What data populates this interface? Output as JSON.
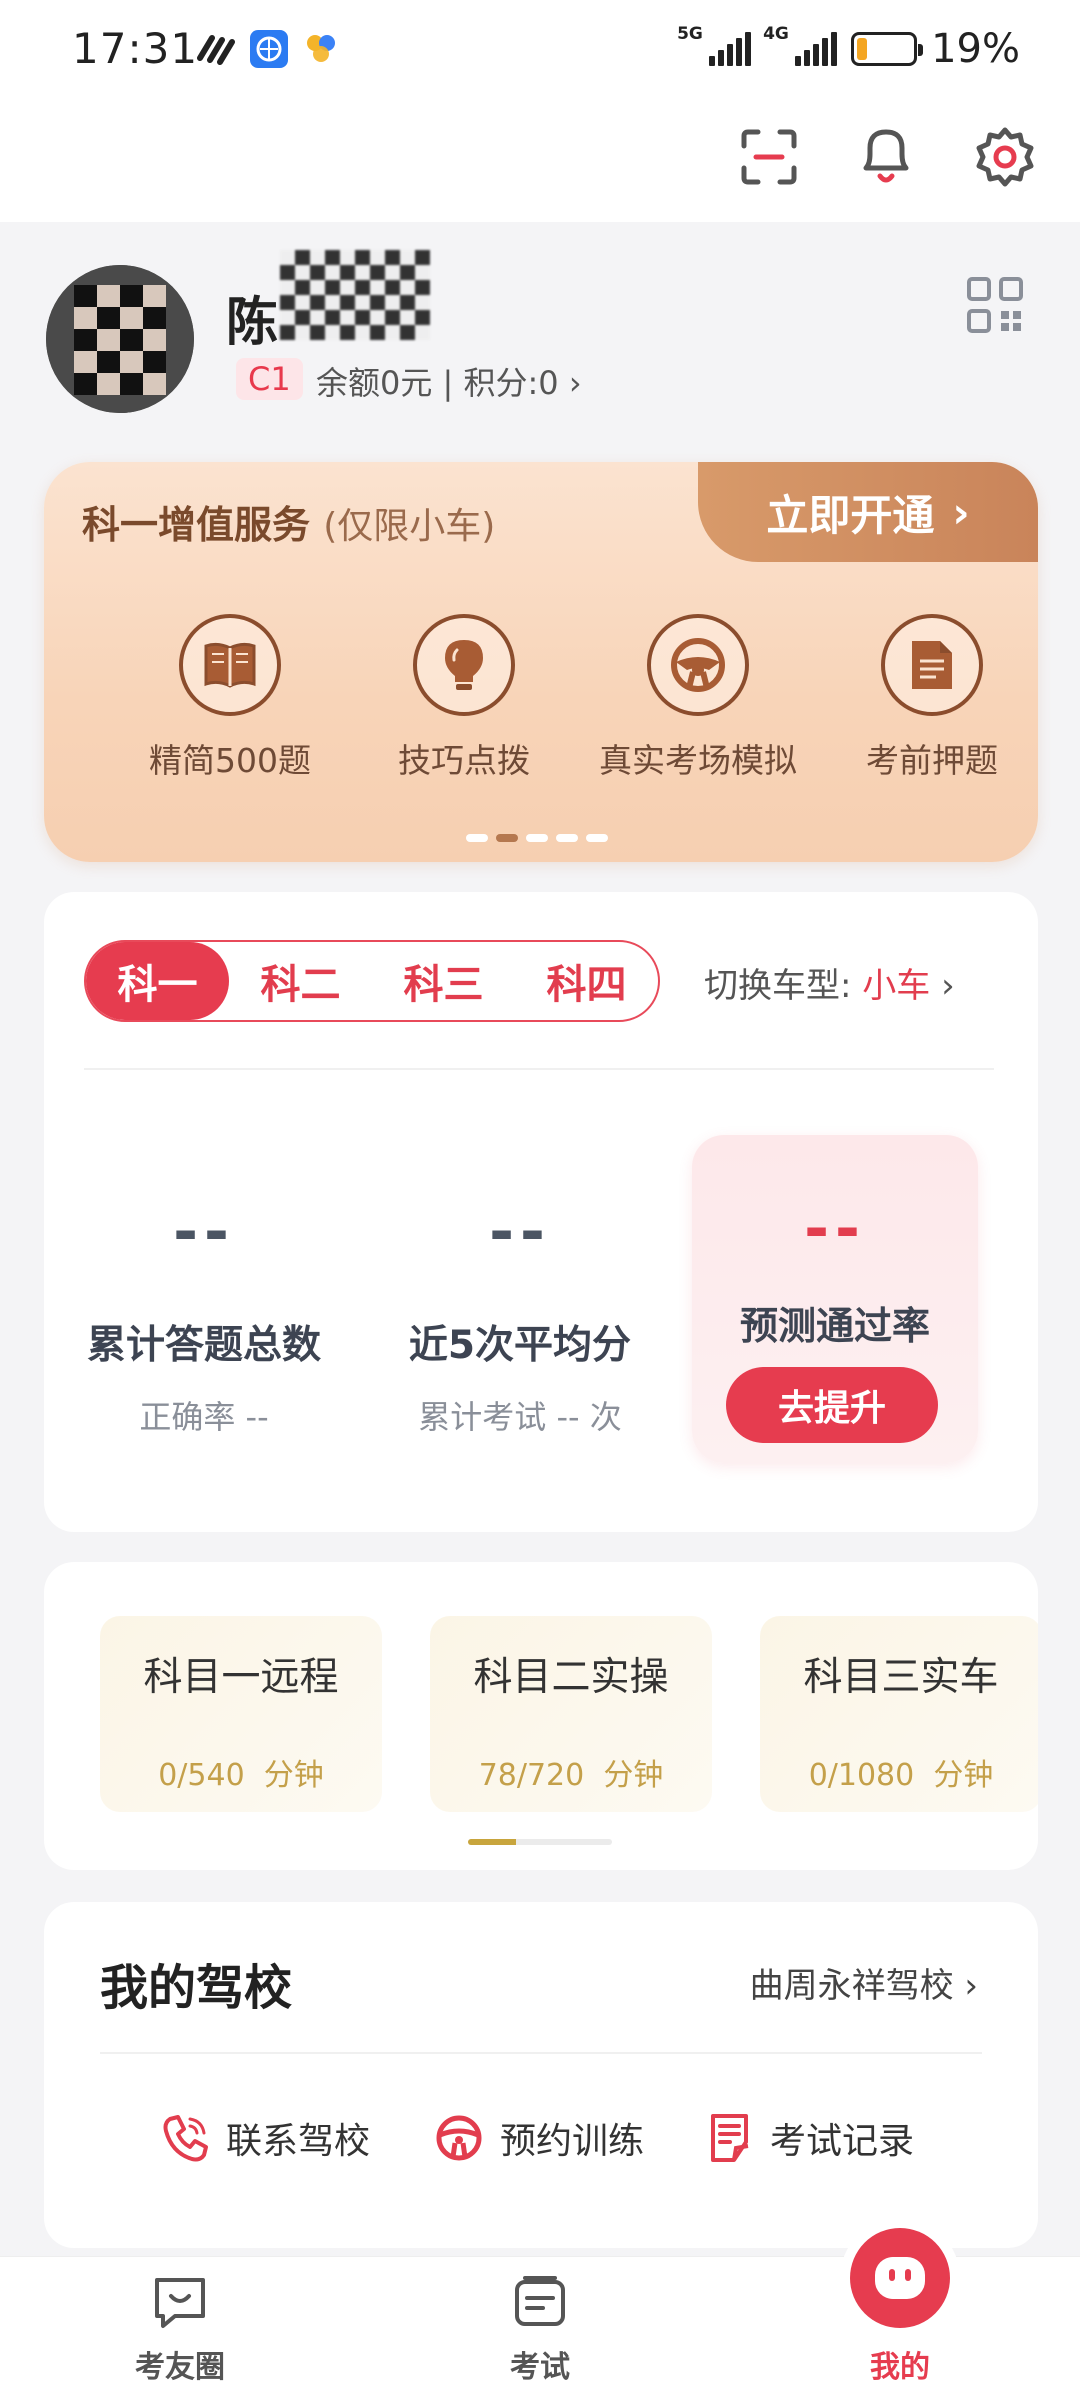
{
  "status_bar": {
    "time": "17:31",
    "net1": "5G",
    "net2": "4G",
    "battery": "19%",
    "battery_level": 0.19
  },
  "header": {
    "icons": [
      "scan-icon",
      "bell-icon",
      "gear-icon"
    ]
  },
  "profile": {
    "name": "陈",
    "license": "C1",
    "balance_points": "余额0元 | 积分:0",
    "icons": [
      "qr-code-icon",
      "chevron-right-icon"
    ]
  },
  "vip": {
    "title": "科一增值服务",
    "subtitle": "(仅限小车)",
    "cta": "立即开通",
    "items": [
      {
        "label": "精简500题",
        "icon": "book-icon"
      },
      {
        "label": "技巧点拨",
        "icon": "lightbulb-icon"
      },
      {
        "label": "真实考场模拟",
        "icon": "steering-wheel-icon"
      },
      {
        "label": "考前押题",
        "icon": "document-icon"
      }
    ]
  },
  "subjects": {
    "tabs": [
      "科一",
      "科二",
      "科三",
      "科四"
    ],
    "active_tab": "科一",
    "switch_label": "切换车型:",
    "switch_value": "小车",
    "stats": [
      {
        "value": "--",
        "label": "累计答题总数",
        "sub": "正确率 --"
      },
      {
        "value": "--",
        "label": "近5次平均分",
        "sub": "累计考试 -- 次"
      }
    ],
    "pass_rate": {
      "value": "--",
      "label": "预测通过率",
      "button": "去提升"
    }
  },
  "courses": [
    {
      "title": "科目一远程",
      "progress": "0/540",
      "unit": "分钟"
    },
    {
      "title": "科目二实操",
      "progress": "78/720",
      "unit": "分钟"
    },
    {
      "title": "科目三实车",
      "progress": "0/1080",
      "unit": "分钟"
    }
  ],
  "school": {
    "title": "我的驾校",
    "name": "曲周永祥驾校",
    "actions": [
      {
        "label": "联系驾校",
        "icon": "phone-icon"
      },
      {
        "label": "预约训练",
        "icon": "steering-wheel-icon"
      },
      {
        "label": "考试记录",
        "icon": "record-icon"
      }
    ]
  },
  "nav": [
    {
      "label": "考友圈",
      "icon": "chat-icon"
    },
    {
      "label": "考试",
      "icon": "exam-icon"
    },
    {
      "label": "我的",
      "icon": "profile-face-icon"
    }
  ],
  "colors": {
    "accent": "#e63c4f",
    "vip_brown": "#8b4d2d",
    "gold": "#c4a04a"
  }
}
